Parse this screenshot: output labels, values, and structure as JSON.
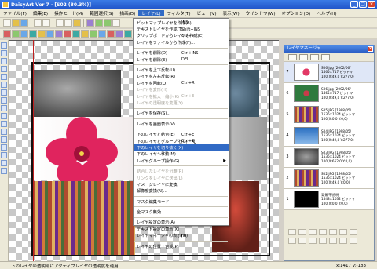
{
  "window": {
    "title": "DaisyArt Ver 7 - [S02 (80.3%)]"
  },
  "menubar": [
    "ファイル(F)",
    "編集(E)",
    "操作モード(M)",
    "範囲選択(S)",
    "描画(D)",
    "レイヤ(L)",
    "フィルタ(T)",
    "ビュー(V)",
    "表示(W)",
    "ウインドウ(W)",
    "オプション(O)",
    "ヘルプ(H)"
  ],
  "layer_menu": {
    "items": [
      {
        "label": "ビットマップレイヤを作成(B)",
        "shortcut": "INS",
        "state": "normal"
      },
      {
        "label": "テキストレイヤを作成(T)",
        "shortcut": "Shift+INS",
        "state": "normal"
      },
      {
        "label": "クリップボードからレイヤを作成(C)",
        "shortcut": "Ctrl+V",
        "state": "normal"
      },
      {
        "label": "レイヤをファイルから作成(F)...",
        "shortcut": "",
        "state": "normal"
      },
      {
        "sep": true
      },
      {
        "label": "レイヤを削除(D)",
        "shortcut": "Ctrl+INS",
        "state": "normal"
      },
      {
        "label": "レイヤを削除(E)",
        "shortcut": "DEL",
        "state": "normal"
      },
      {
        "sep": true
      },
      {
        "label": "レイヤを上下反転(U)",
        "shortcut": "",
        "state": "normal"
      },
      {
        "label": "レイヤを左右反転(R)",
        "shortcut": "",
        "state": "normal"
      },
      {
        "label": "レイヤを回転(O)",
        "shortcut": "Ctrl+R",
        "state": "normal"
      },
      {
        "label": "レイヤを変形(H)",
        "shortcut": "",
        "state": "disabled"
      },
      {
        "label": "レイヤを拡大・縮小(K)",
        "shortcut": "Ctrl+E",
        "state": "disabled"
      },
      {
        "label": "レイヤの透明度を変更(Y)",
        "shortcut": "",
        "state": "disabled"
      },
      {
        "sep": true
      },
      {
        "label": "レイヤを保存(S)...",
        "shortcut": "",
        "state": "normal"
      },
      {
        "sep": true
      },
      {
        "label": "レイヤを画面表示(V)",
        "shortcut": "",
        "state": "normal"
      },
      {
        "sep": true
      },
      {
        "label": "下のレイヤと結合(E)",
        "shortcut": "Ctrl+E",
        "state": "normal"
      },
      {
        "label": "下のレイヤとグループ化(G)",
        "shortcut": "Ctrl+G",
        "state": "normal"
      },
      {
        "label": "下のレイヤを切り抜く(X)",
        "shortcut": "",
        "state": "highlighted"
      },
      {
        "label": "下のレイヤへ移動(M)",
        "shortcut": "",
        "state": "normal"
      },
      {
        "label": "レイヤグループ操作(G)",
        "shortcut": "",
        "state": "normal",
        "submenu": true
      },
      {
        "sep": true
      },
      {
        "label": "結合したレイヤを分離(R)",
        "shortcut": "",
        "state": "disabled"
      },
      {
        "label": "リンクをレイヤに送出(L)",
        "shortcut": "",
        "state": "disabled"
      },
      {
        "label": "イメージレイヤに変換",
        "shortcut": "",
        "state": "normal"
      },
      {
        "label": "解像度変換(N)...",
        "shortcut": "",
        "state": "normal"
      },
      {
        "sep": true
      },
      {
        "label": "マスク編集モード",
        "shortcut": "",
        "state": "normal"
      },
      {
        "sep": true
      },
      {
        "label": "全マスク無効",
        "shortcut": "",
        "state": "normal"
      },
      {
        "sep": true
      },
      {
        "label": "レイヤ設定の表示(A)",
        "shortcut": "",
        "state": "normal"
      },
      {
        "label": "テキスト設定の表示(X)",
        "shortcut": "",
        "state": "normal"
      },
      {
        "label": "レイヤマネージャの表示(M)",
        "shortcut": "F8",
        "state": "normal"
      },
      {
        "sep": true
      },
      {
        "label": "レイヤの位置・合成(P)",
        "shortcut": "",
        "state": "normal"
      }
    ]
  },
  "layer_manager": {
    "title": "レイヤマネージャ",
    "close": "×",
    "layers": [
      {
        "num": "7",
        "thumb": "flower",
        "info": "S06.jpg [2002/06/\n1465×717 ビットマ\n100(X:49,0 Y:277,0)"
      },
      {
        "num": "6",
        "thumb": "green",
        "info": "S06.jpg [2002/06/\n1465×717 ビットマ\n100(X:49,0 Y:277,0)"
      },
      {
        "num": "5",
        "thumb": "crowd",
        "info": "S05.JPG [1998/05/\n1536×1024 ビットマ\n100(X:0,0 Y:0,0)"
      },
      {
        "num": "4",
        "thumb": "blue",
        "info": "S04.JPG [1998/05/\n1536×1024 ビットマ\n100(X:49,0 Y:277,0)"
      },
      {
        "num": "3",
        "thumb": "statue",
        "info": "S03.JPG [1998/05/\n1536×1024 ビットマ\n100(X:652,0 Y:0,0)"
      },
      {
        "num": "2",
        "thumb": "crowd",
        "info": "S02.JPG [1998/05/\n1536×1024 ビットマ\n100(X:49,0 Y:0,0)"
      },
      {
        "num": "1",
        "thumb": "black",
        "info": "背景/不透明\n1548×1032 ビットマ\n100(X:0,0 Y:0,0)"
      }
    ]
  },
  "statusbar": {
    "message": "下のレイヤの透明部にアクティブレイヤの透明度を適用",
    "coords": "x:1417 y:-183"
  }
}
